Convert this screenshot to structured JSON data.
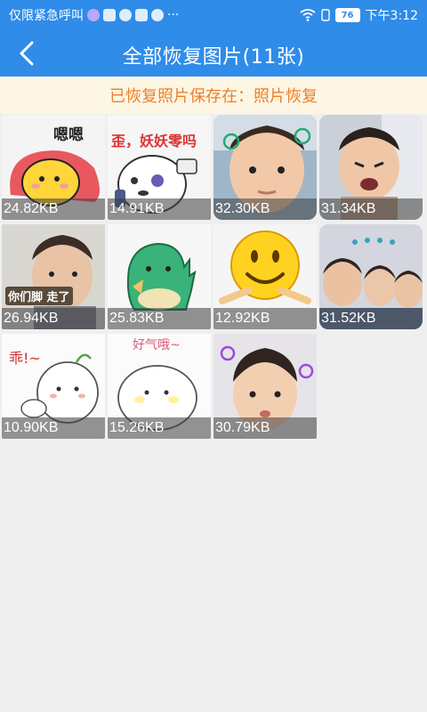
{
  "status_bar": {
    "carrier_text": "仅限紧急呼叫",
    "more": "···",
    "battery": "76",
    "time": "下午3:12"
  },
  "header": {
    "title": "全部恢复图片(11张)"
  },
  "banner": {
    "text": "已恢复照片保存在：照片恢复"
  },
  "photos": [
    {
      "size": "24.82KB",
      "caption": "嗯嗯"
    },
    {
      "size": "14.91KB",
      "caption": "歪，妖妖零吗"
    },
    {
      "size": "32.30KB"
    },
    {
      "size": "31.34KB"
    },
    {
      "size": "26.94KB",
      "caption": "你们脚 走了"
    },
    {
      "size": "25.83KB"
    },
    {
      "size": "12.92KB"
    },
    {
      "size": "31.52KB"
    },
    {
      "size": "10.90KB",
      "caption": "乖!~"
    },
    {
      "size": "15.26KB",
      "caption": "好气哦~"
    },
    {
      "size": "30.79KB"
    }
  ],
  "colors": {
    "primary": "#2f8ce8",
    "banner_bg": "#fdf6e4",
    "banner_text": "#ee7f2a"
  }
}
